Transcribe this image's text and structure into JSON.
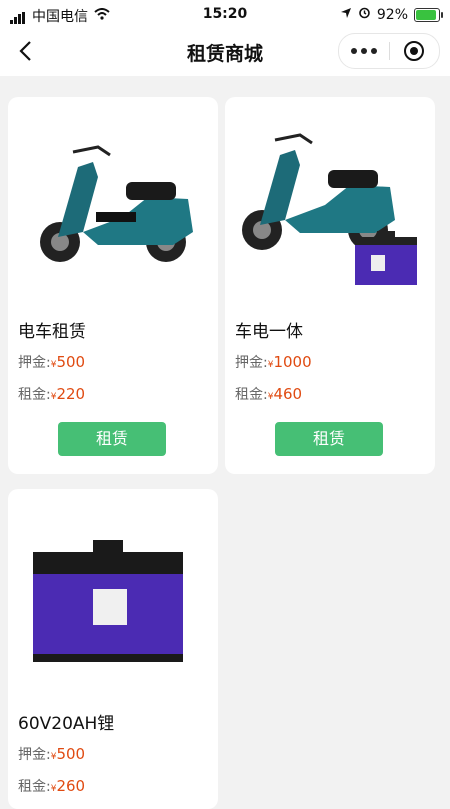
{
  "status_bar": {
    "carrier": "中国电信",
    "time": "15:20",
    "battery": "92%",
    "battery_level": 0.92,
    "accent_battery": "#39c23f"
  },
  "nav": {
    "title": "租赁商城",
    "back_icon": "chevron-left-icon",
    "more_icon": "more-dots-icon",
    "close_icon": "target-icon"
  },
  "colors": {
    "button_green": "#46bf75",
    "price_orange": "#e04b12"
  },
  "products": [
    {
      "name": "电车租赁",
      "deposit_label": "押金:",
      "deposit_currency": "¥",
      "deposit": "500",
      "rent_label": "租金:",
      "rent_currency": "¥",
      "rent": "220",
      "button": "租赁",
      "image": "electric-scooter"
    },
    {
      "name": "车电一体",
      "deposit_label": "押金:",
      "deposit_currency": "¥",
      "deposit": "1000",
      "rent_label": "租金:",
      "rent_currency": "¥",
      "rent": "460",
      "button": "租赁",
      "image": "scooter-with-battery"
    },
    {
      "name": "60V20AH锂",
      "deposit_label": "押金:",
      "deposit_currency": "¥",
      "deposit": "500",
      "rent_label": "租金:",
      "rent_currency": "¥",
      "rent": "260",
      "button": "",
      "image": "lithium-battery"
    }
  ]
}
